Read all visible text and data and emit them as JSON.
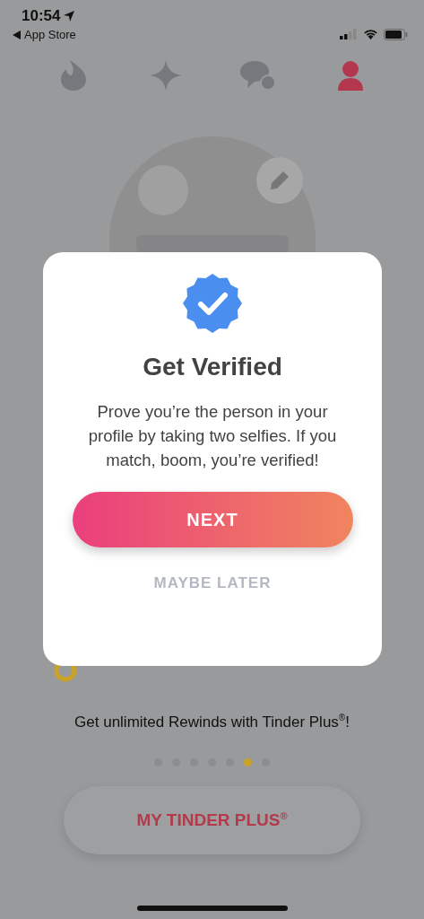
{
  "status_bar": {
    "time": "10:54",
    "back_label": "App Store"
  },
  "tabs": [
    {
      "kind": "flame",
      "selected": false
    },
    {
      "kind": "sparkle",
      "selected": false
    },
    {
      "kind": "chat",
      "selected": false
    },
    {
      "kind": "profile",
      "selected": true
    }
  ],
  "plus_promo": {
    "text": "Get unlimited Rewinds with Tinder Plus$^{®}$!",
    "pages": [
      {
        "selected": false
      },
      {
        "selected": false
      },
      {
        "selected": false
      },
      {
        "selected": false
      },
      {
        "selected": false
      },
      {
        "selected": true
      },
      {
        "selected": false
      }
    ],
    "button": "MY TINDER PLUS$^{®}$"
  },
  "dialog": {
    "title": "Get Verified",
    "body": "Prove you’re the person in your profile by taking two selfies. If you match, boom, you’re verified!",
    "primary_button": "NEXT",
    "secondary_button": "MAYBE LATER"
  }
}
